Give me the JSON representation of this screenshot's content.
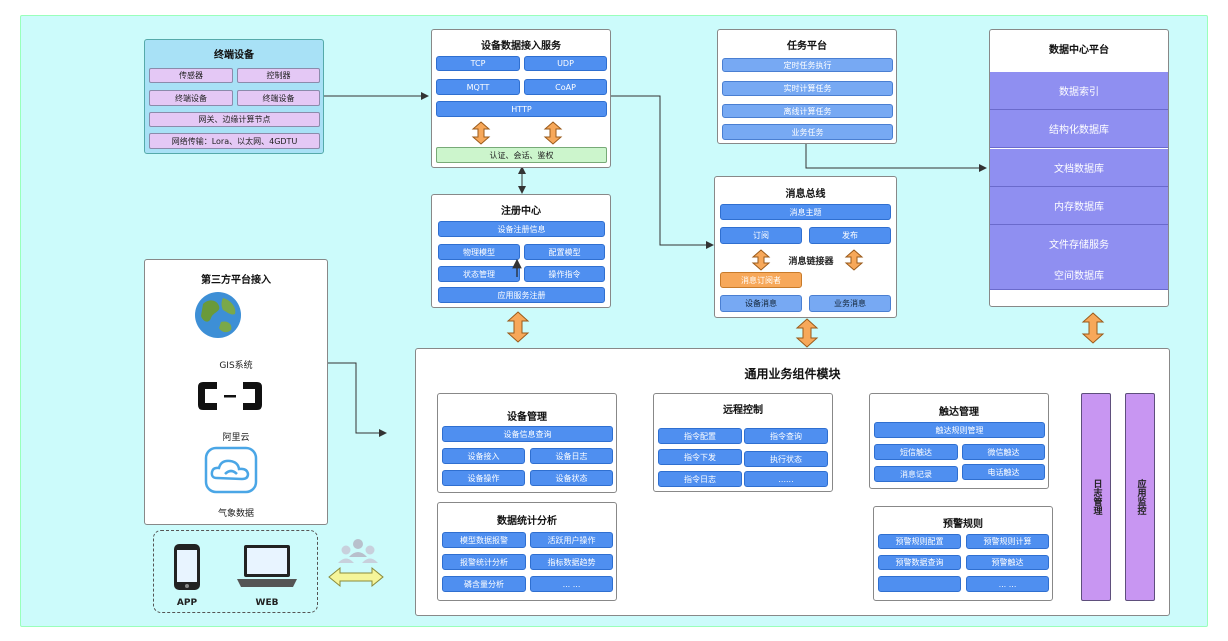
{
  "terminal": {
    "title": "终端设备",
    "items": [
      "传感器",
      "控制器",
      "终端设备",
      "终端设备"
    ],
    "gateway": "网关、边缘计算节点",
    "network": "网络传输：Lora、以太网、4GDTU"
  },
  "access": {
    "title": "设备数据接入服务",
    "protocols": [
      "TCP",
      "UDP",
      "MQTT",
      "CoAP",
      "HTTP"
    ],
    "auth": "认证、会话、鉴权"
  },
  "registry": {
    "title": "注册中心",
    "items": [
      "设备注册信息",
      "物理模型",
      "配置模型",
      "状态管理",
      "操作指令",
      "应用服务注册"
    ]
  },
  "task": {
    "title": "任务平台",
    "items": [
      "定时任务执行",
      "实时计算任务",
      "离线计算任务",
      "业务任务"
    ]
  },
  "bus": {
    "title": "消息总线",
    "topic": "消息主题",
    "subscribe": "订阅",
    "publish": "发布",
    "connector": "消息链接器",
    "subscriber": "消息订阅者",
    "device_msg": "设备消息",
    "biz_msg": "业务消息"
  },
  "datacenter": {
    "title": "数据中心平台",
    "items": [
      "数据索引",
      "结构化数据库",
      "文档数据库",
      "内存数据库",
      "文件存储服务",
      "空间数据库"
    ]
  },
  "third": {
    "title": "第三方平台接入",
    "gis": "GIS系统",
    "aliyun": "阿里云",
    "weather": "气象数据",
    "aliyun_logo": "(–)"
  },
  "clients": {
    "app": "APP",
    "web": "WEB"
  },
  "common": {
    "title": "通用业务组件模块",
    "device": {
      "title": "设备管理",
      "items": [
        "设备信息查询",
        "设备接入",
        "设备日志",
        "设备操作",
        "设备状态"
      ]
    },
    "remote": {
      "title": "远程控制",
      "items": [
        "指令配置",
        "指令查询",
        "指令下发",
        "执行状态",
        "指令日志",
        "......"
      ]
    },
    "reach": {
      "title": "触达管理",
      "items": [
        "触达规则管理",
        "短信触达",
        "微信触达",
        "消息记录",
        "电话触达"
      ]
    },
    "stats": {
      "title": "数据统计分析",
      "items": [
        "模型数据报警",
        "活跃用户操作",
        "报警统计分析",
        "指标数据趋势",
        "磷含量分析",
        "... ..."
      ]
    },
    "alert": {
      "title": "预警规则",
      "items": [
        "预警规则配置",
        "预警规则计算",
        "预警数据查询",
        "预警触达",
        "",
        "... ..."
      ]
    },
    "log": "日志管理",
    "monitor": "应用监控"
  },
  "colors": {
    "canvas": "#ccfbfb",
    "blue": "#4f8ff0",
    "purple": "#8f8ff1",
    "lavender": "#e4c8f5",
    "green": "#ccf5cc",
    "orange": "#f7a85a"
  },
  "icons": [
    "globe-icon",
    "aliyun-logo-icon",
    "weather-cloud-icon",
    "phone-icon",
    "laptop-icon",
    "users-icon",
    "double-arrow-icon"
  ]
}
